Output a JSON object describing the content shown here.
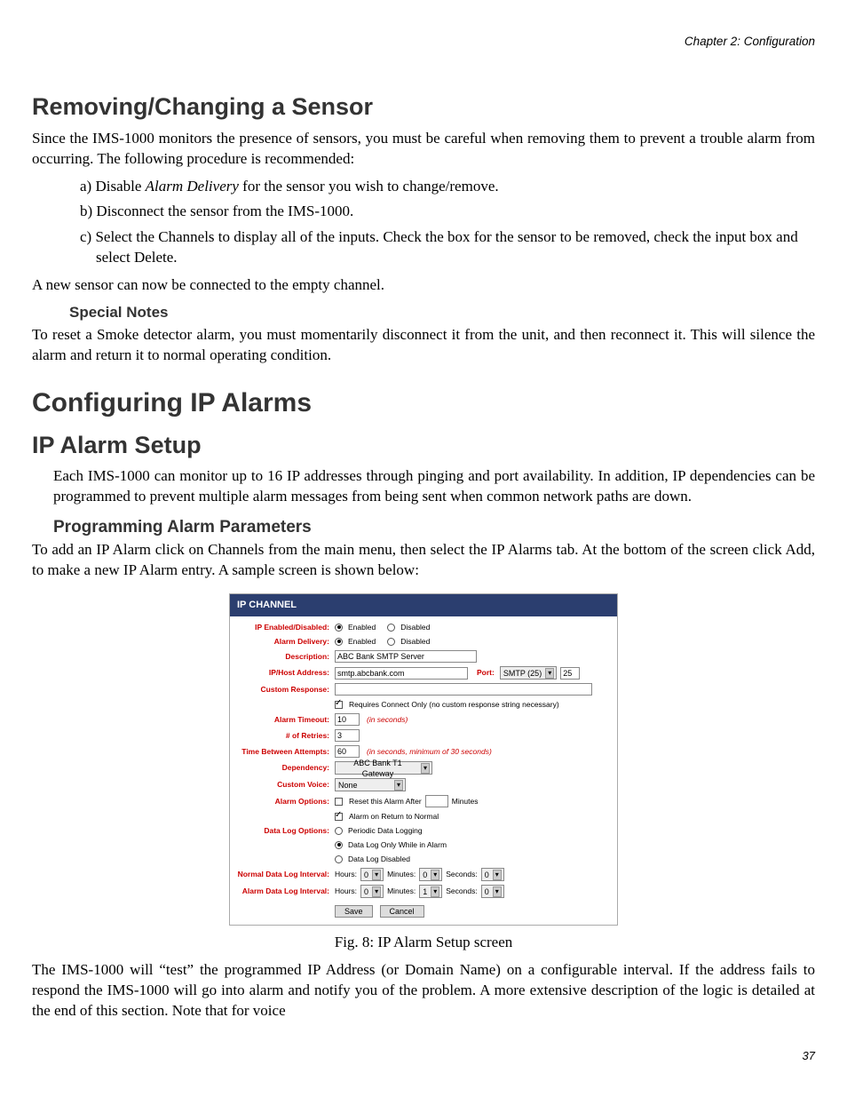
{
  "chapter_header": "Chapter 2: Configuration",
  "section_removing": "Removing/Changing a Sensor",
  "removing_intro": "Since the IMS-1000 monitors the presence of sensors, you must be careful when removing them to prevent a trouble alarm from occurring. The following procedure is recommended:",
  "step_a_pre": "a) Disable ",
  "step_a_italic": "Alarm Delivery",
  "step_a_post": " for the sensor you wish to change/remove.",
  "step_b": "b) Disconnect the sensor from the IMS-1000.",
  "step_c": "c) Select the Channels to display all of the inputs. Check the box for the sensor to be removed, check the input box and select Delete.",
  "removing_after": "A new sensor can now be connected to the empty channel.",
  "special_notes_h": "Special Notes",
  "special_notes_p": "To reset a Smoke detector alarm, you must momentarily disconnect it from the unit, and then reconnect it. This will silence the alarm and return it to normal operating condition.",
  "config_h": "Configuring IP Alarms",
  "ip_setup_h": "IP Alarm Setup",
  "ip_setup_p": "Each IMS-1000 can monitor up to 16 IP addresses through pinging and port availability. In addition, IP dependencies can be programmed to prevent multiple alarm messages from being sent when common network paths are down.",
  "prog_h": "Programming Alarm Parameters",
  "prog_p": "To add an IP Alarm click on Channels from the main menu, then select the IP Alarms tab. At the bottom of the screen click Add, to make a new IP Alarm entry. A sample screen is shown below:",
  "figcap": "Fig. 8: IP Alarm Setup screen",
  "after_fig": "The IMS-1000 will “test” the programmed IP Address (or Domain Name) on a configurable interval. If the address fails to respond the IMS-1000 will go into alarm and notify you of the problem. A more extensive description of the logic is detailed at the end of this section. Note that for voice",
  "page_num": "37",
  "panel": {
    "title": "IP CHANNEL",
    "labels": {
      "enabled": "IP Enabled/Disabled:",
      "delivery": "Alarm Delivery:",
      "description": "Description:",
      "host": "IP/Host Address:",
      "port": "Port:",
      "custom_response": "Custom Response:",
      "requires_connect": "Requires Connect Only (no custom response string necessary)",
      "timeout": "Alarm Timeout:",
      "timeout_hint": "(in seconds)",
      "retries": "# of Retries:",
      "between": "Time Between Attempts:",
      "between_hint": "(in seconds, minimum of 30 seconds)",
      "dependency": "Dependency:",
      "voice": "Custom Voice:",
      "alarm_options": "Alarm Options:",
      "reset_after": "Reset this Alarm After",
      "minutes_word": "Minutes",
      "return_normal": "Alarm on Return to Normal",
      "datalog_options": "Data Log Options:",
      "dl_periodic": "Periodic Data Logging",
      "dl_only_alarm": "Data Log Only While in Alarm",
      "dl_disabled": "Data Log Disabled",
      "normal_interval": "Normal Data Log Interval:",
      "alarm_interval": "Alarm Data Log Interval:",
      "hours": "Hours:",
      "minutes": "Minutes:",
      "seconds": "Seconds:",
      "enabled_opt": "Enabled",
      "disabled_opt": "Disabled",
      "save": "Save",
      "cancel": "Cancel"
    },
    "values": {
      "description": "ABC Bank SMTP Server",
      "host": "smtp.abcbank.com",
      "port_select": "SMTP (25)",
      "port_num": "25",
      "custom_response": "",
      "timeout": "10",
      "retries": "3",
      "between": "60",
      "dependency": "ABC Bank T1 Gateway",
      "voice": "None",
      "reset_minutes": "",
      "n_hours": "0",
      "n_min": "0",
      "n_sec": "0",
      "a_hours": "0",
      "a_min": "1",
      "a_sec": "0"
    }
  }
}
